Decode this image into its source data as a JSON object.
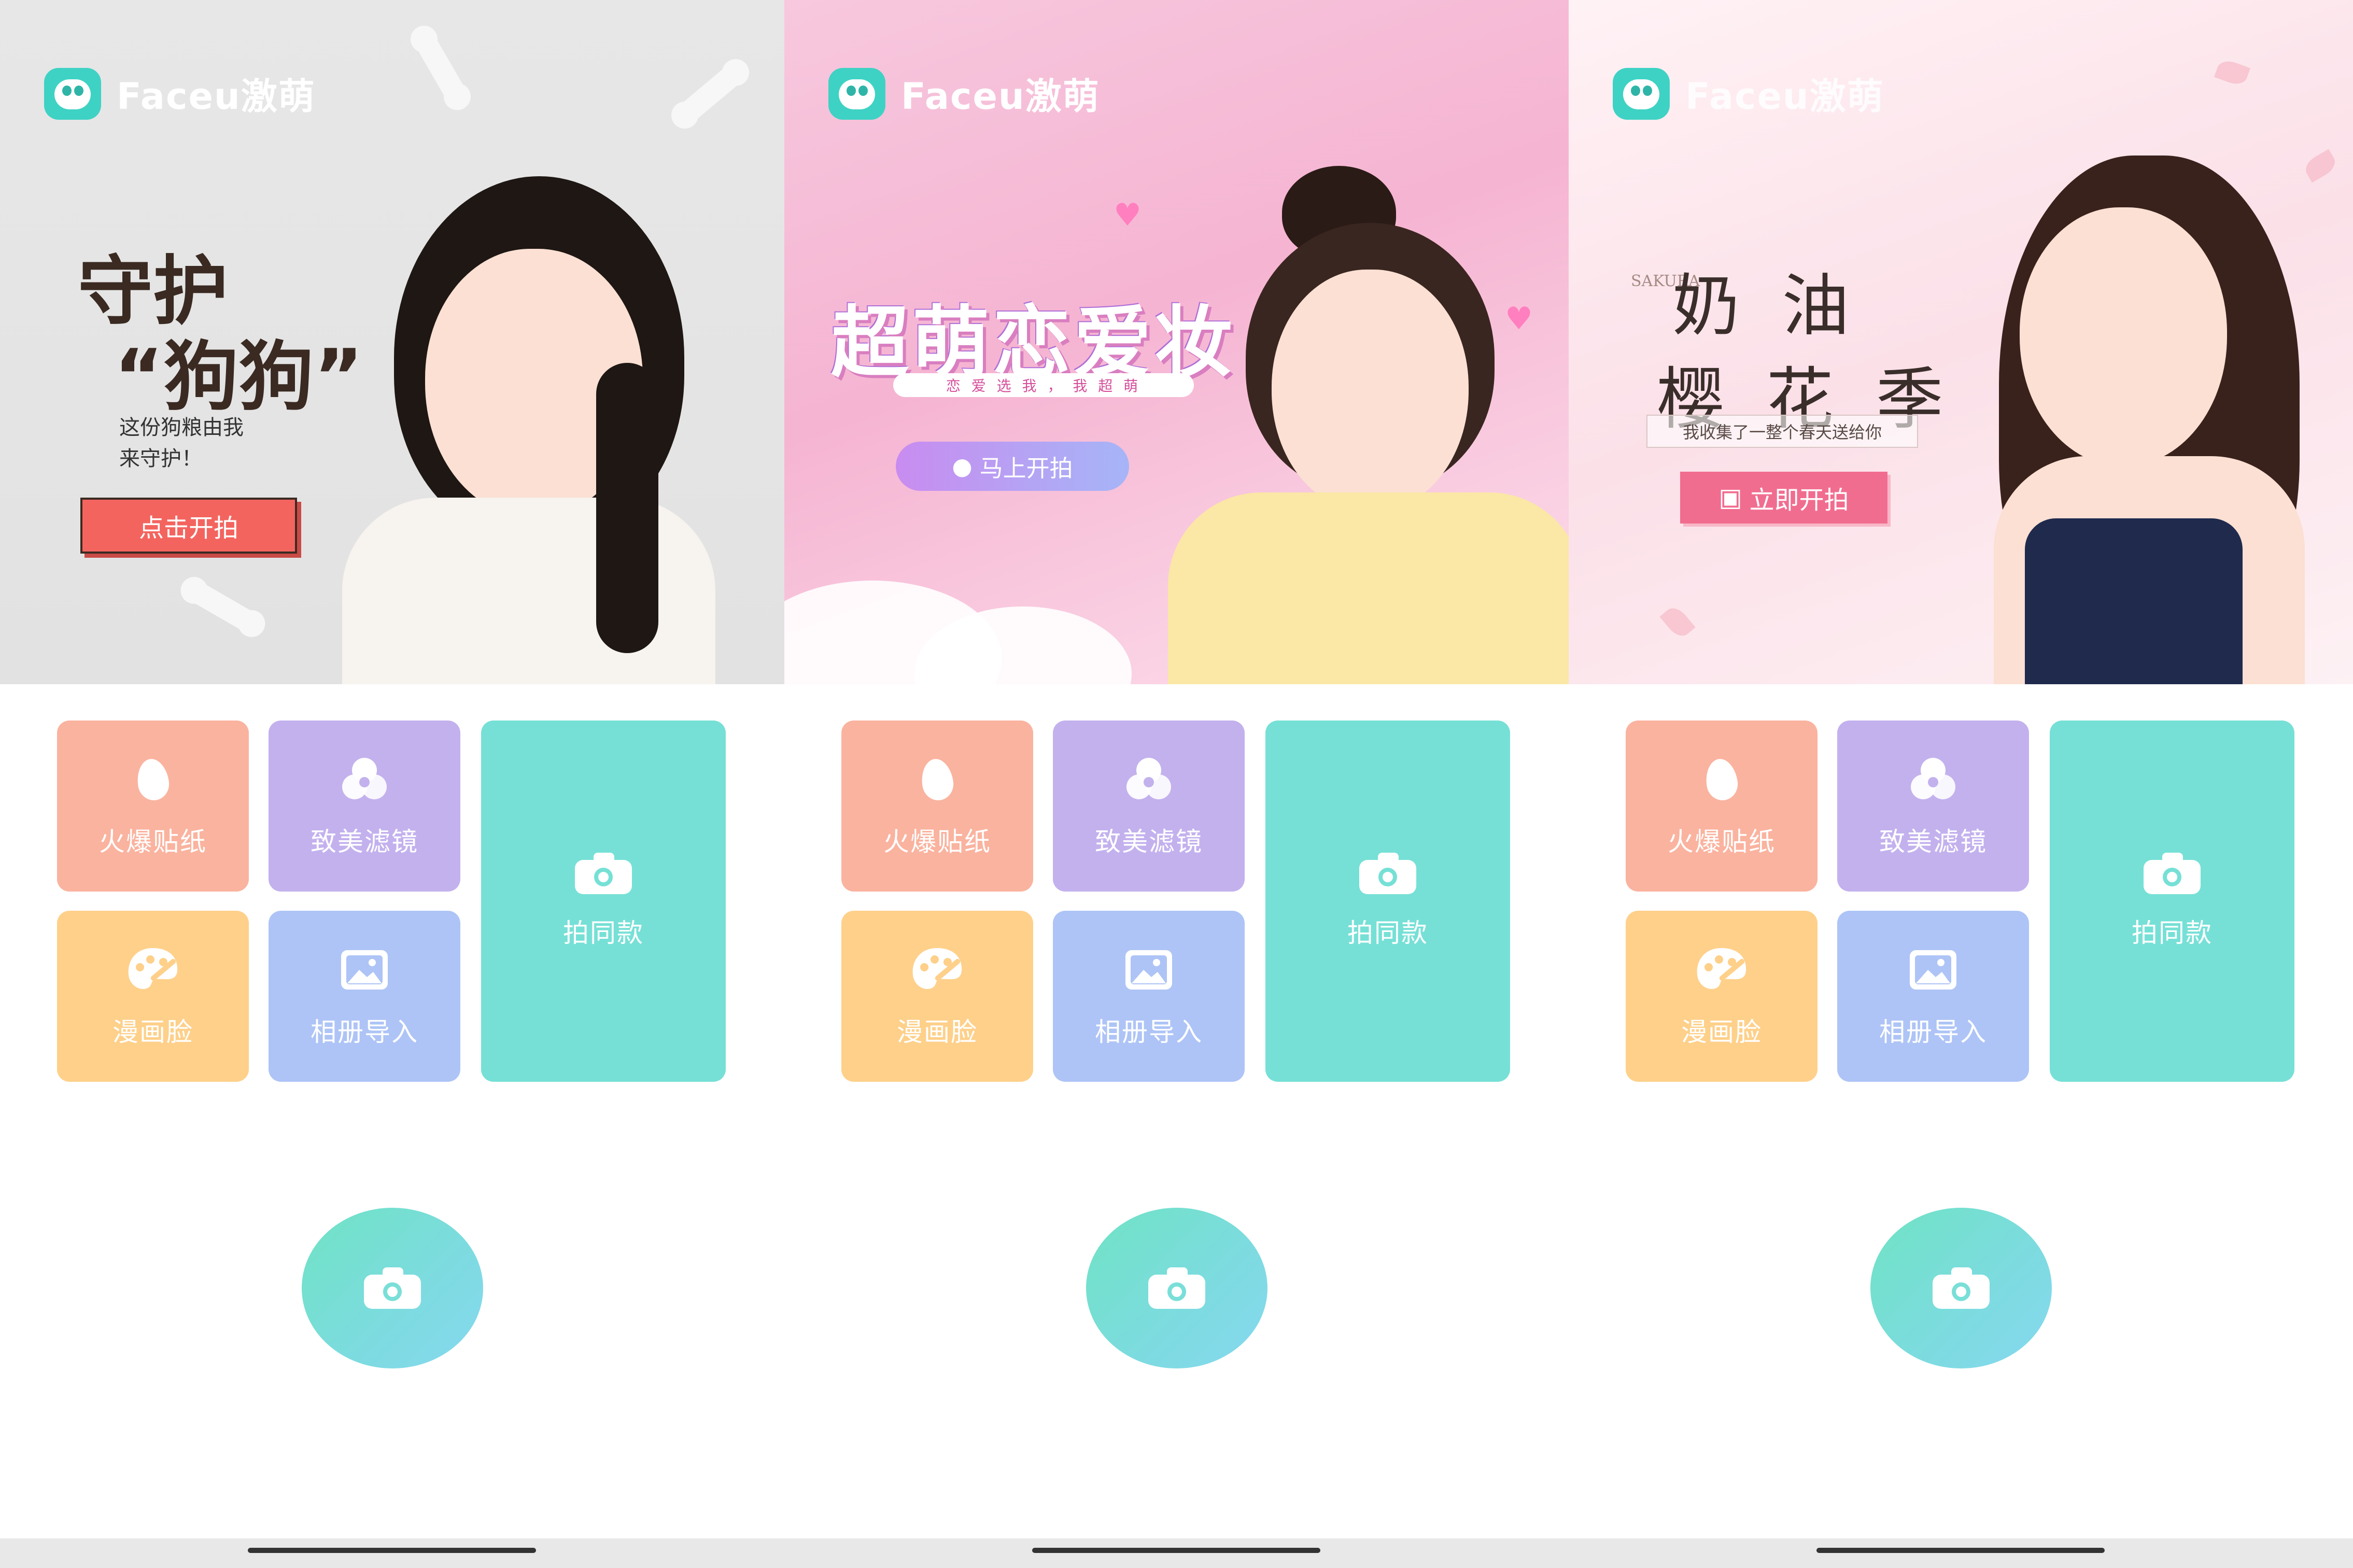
{
  "app": {
    "logo_text": "Faceu激萌"
  },
  "panels": [
    {
      "banner": {
        "title_line1": "守护",
        "title_line2": "“狗狗”",
        "subtitle_line1": "这份狗粮由我",
        "subtitle_line2": "来守护！",
        "cta": "点击开拍"
      }
    },
    {
      "banner": {
        "title": "超萌恋爱妆",
        "tagline": "恋 爱 选 我 ， 我 超 萌",
        "cta": "马上开拍"
      }
    },
    {
      "banner": {
        "side_text": "SAKURA",
        "title_line1": "奶 油",
        "title_line2": "樱 花 季",
        "subtitle": "我收集了一整个春天送给你",
        "cta": "立即开拍"
      }
    }
  ],
  "tiles": {
    "hot_stickers": "火爆贴纸",
    "beauty_filters": "致美滤镜",
    "comic_face": "漫画脸",
    "album_import": "相册导入",
    "shoot_same": "拍同款"
  },
  "icons": {
    "hot_stickers": "flame-icon",
    "beauty_filters": "filter-circles-icon",
    "comic_face": "palette-icon",
    "album_import": "image-icon",
    "shoot_same": "camera-icon",
    "shutter": "camera-icon"
  },
  "colors": {
    "hot_stickers": "#fab39f",
    "beauty_filters": "#c3b1ee",
    "comic_face": "#fed08a",
    "album_import": "#aec4f6",
    "shoot_same": "#76e0d6",
    "brand": "#3ed2c4"
  }
}
